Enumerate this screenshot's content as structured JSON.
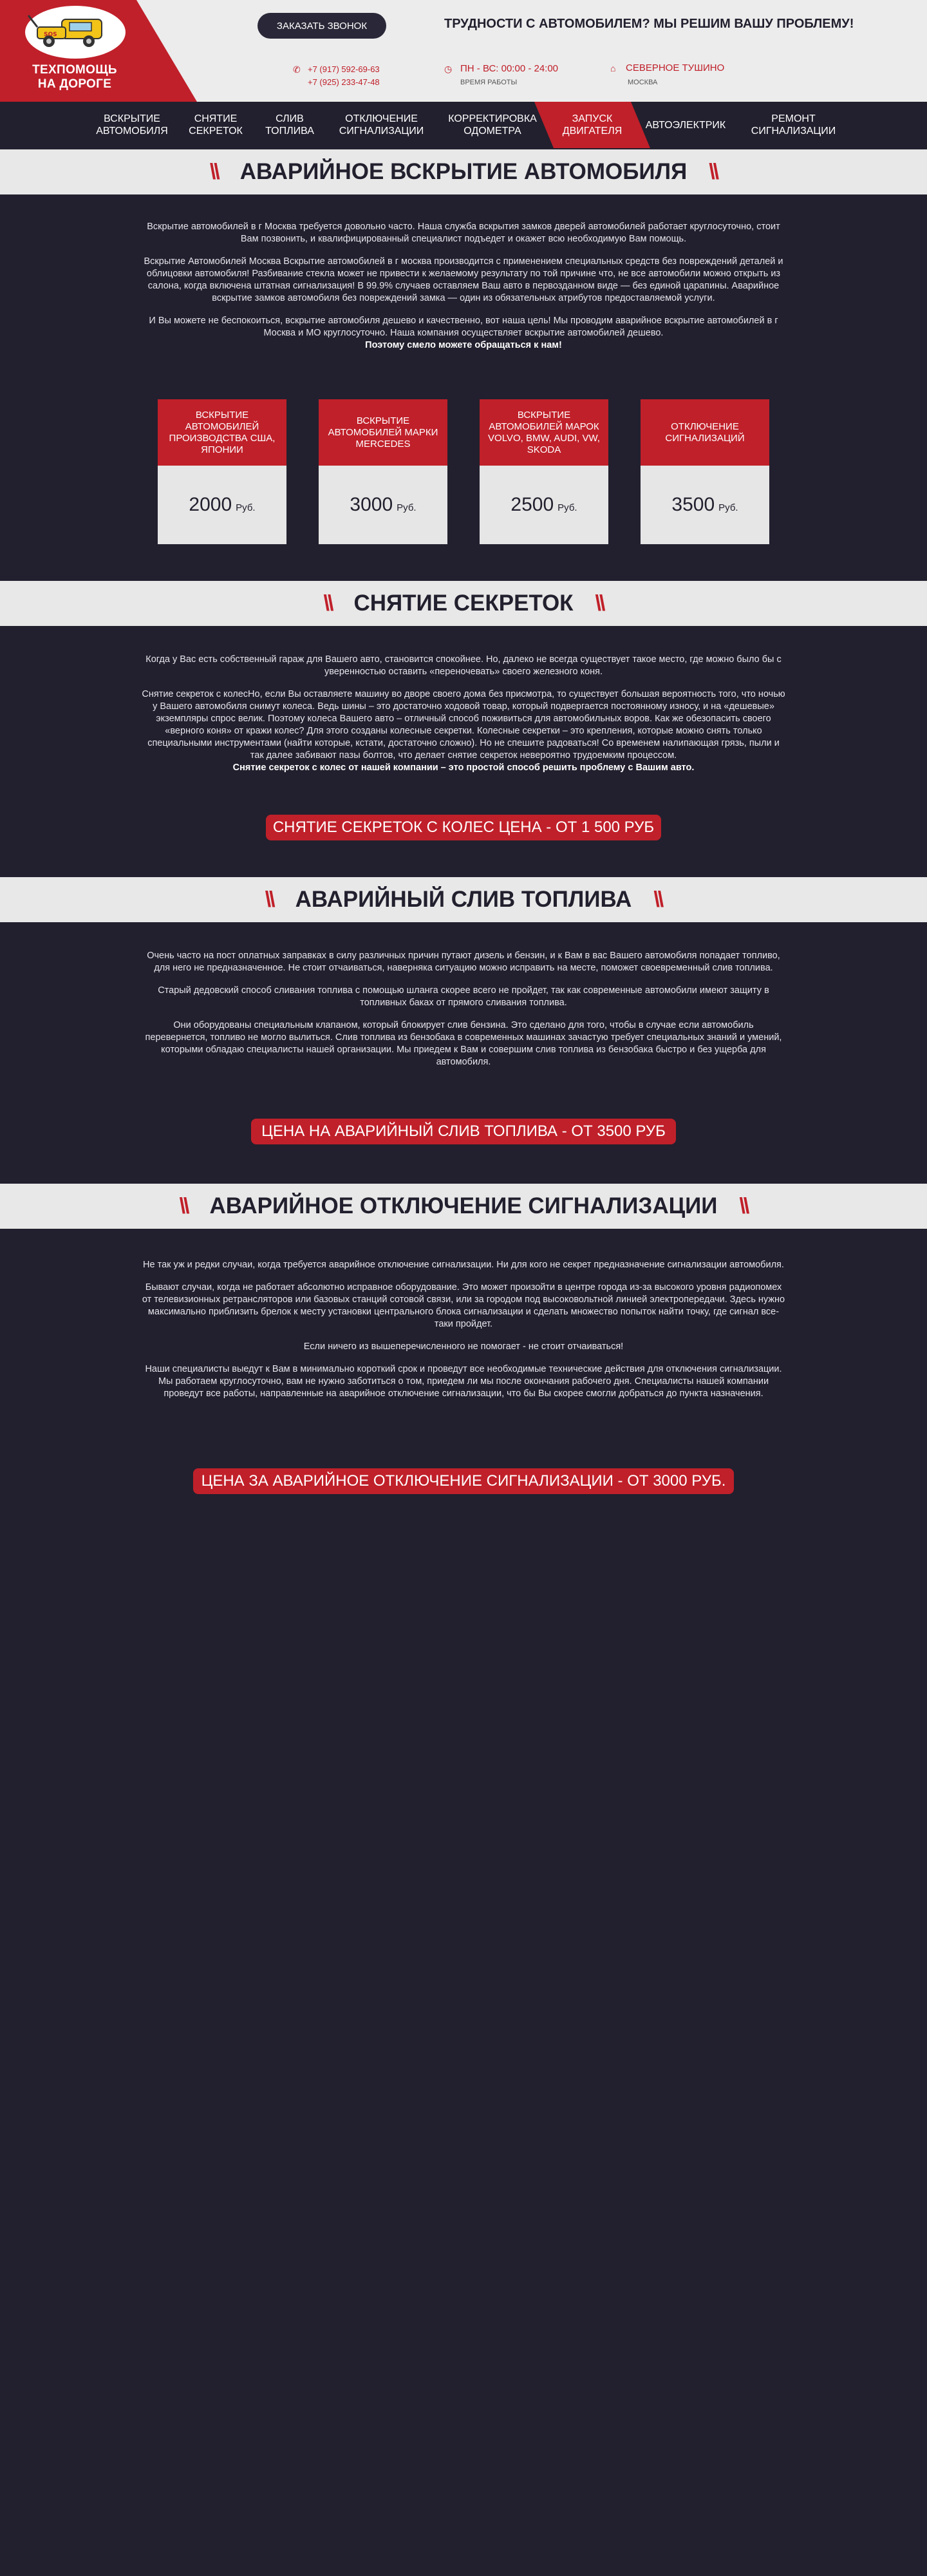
{
  "header": {
    "logo_alt": "tow truck logo",
    "logo_line1": "ТЕХПОМОЩЬ",
    "logo_line2": "НА ДОРОГЕ",
    "callback_label": "ЗАКАЗАТЬ ЗВОНОК",
    "tagline": "ТРУДНОСТИ С АВТОМОБИЛЕМ? МЫ РЕШИМ ВАШУ ПРОБЛЕМУ!",
    "phone1": "+7 (917) 592-69-63",
    "phone2": "+7 (925) 233-47-48",
    "hours": "ПН - ВС: 00:00 - 24:00",
    "hours_label": "ВРЕМЯ РАБОТЫ",
    "location": "СЕВЕРНОЕ ТУШИНО",
    "city": "МОСКВА",
    "icons": {
      "phone": "phone-icon",
      "clock": "clock-icon",
      "home": "home-icon"
    },
    "brand_color": "#c0202a"
  },
  "nav": [
    {
      "l1": "ВСКРЫТИЕ",
      "l2": "АВТОМОБИЛЯ"
    },
    {
      "l1": "СНЯТИЕ",
      "l2": "СЕКРЕТОК"
    },
    {
      "l1": "СЛИВ",
      "l2": "ТОПЛИВА"
    },
    {
      "l1": "ОТКЛЮЧЕНИЕ",
      "l2": "СИГНАЛИЗАЦИИ"
    },
    {
      "l1": "КОРРЕКТИРОВКА",
      "l2": "ОДОМЕТРА"
    },
    {
      "l1": "ЗАПУСК",
      "l2": "ДВИГАТЕЛЯ"
    },
    {
      "l1": "АВТОЭЛЕКТРИК",
      "l2": ""
    },
    {
      "l1": "РЕМОНТ",
      "l2": "СИГНАЛИЗАЦИИ"
    }
  ],
  "sections": {
    "s1": {
      "title": "АВАРИЙНОЕ ВСКРЫТИЕ АВТОМОБИЛЯ",
      "p1": "Вскрытие автомобилей в г Москва требуется довольно часто. Наша служба вскрытия замков дверей автомобилей работает круглосуточно, стоит Вам позвонить, и квалифицированный специалист подъедет и окажет всю необходимую Вам помощь.",
      "p2": "Вскрытие Автомобилей Москва Вскрытие автомобилей в г москва производится с применением специальных средств без повреждений деталей и облицовки автомобиля! Разбивание стекла может не привести к желаемому результату по той причине что, не все автомобили можно открыть из салона, когда включена штатная сигнализация! В 99.9% случаев оставляем Ваш авто в первозданном виде — без единой царапины. Аварийное вскрытие замков автомобиля без повреждений замка — один из обязательных атрибутов предоставляемой услуги.",
      "p3": "И Вы можете не беспокоиться, вскрытие автомобиля дешево и качественно, вот наша цель! Мы проводим аварийное вскрытие автомобилей в г Москва и МО круглосуточно. Наша компания осуществляет вскрытие автомобилей дешево.",
      "p3b": "Поэтому смело можете обращаться к нам!",
      "cards": [
        {
          "title": "ВСКРЫТИЕ АВТОМОБИЛЕЙ ПРОИЗВОДСТВА США, ЯПОНИИ",
          "price": "2000",
          "cur": "Руб."
        },
        {
          "title": "ВСКРЫТИЕ АВТОМОБИЛЕЙ МАРКИ MERCEDES",
          "price": "3000",
          "cur": "Руб."
        },
        {
          "title": "ВСКРЫТИЕ АВТОМОБИЛЕЙ МАРОК VOLVO, BMW, AUDI, VW, SKODA",
          "price": "2500",
          "cur": "Руб."
        },
        {
          "title": "ОТКЛЮЧЕНИЕ СИГНАЛИЗАЦИЙ",
          "price": "3500",
          "cur": "Руб."
        }
      ]
    },
    "s2": {
      "title": "СНЯТИЕ СЕКРЕТОК",
      "p1": "Когда у Вас есть собственный гараж для Вашего авто, становится спокойнее. Но, далеко не всегда существует такое место, где можно было бы с уверенностью оставить «переночевать» своего железного коня.",
      "p2": "Снятие секреток с колесНо, если Вы оставляете машину во дворе своего дома без присмотра, то существует большая вероятность того, что ночью у Вашего автомобиля снимут колеса. Ведь шины – это достаточно ходовой товар, который подвергается постоянному износу, и на «дешевые» экземпляры спрос велик. Поэтому колеса Вашего авто – отличный способ поживиться для автомобильных воров. Как же обезопасить своего «верного коня» от кражи колес? Для этого созданы колесные секретки. Колесные секретки – это крепления, которые можно снять только специальными инструментами (найти которые, кстати, достаточно сложно). Но не спешите радоваться! Со временем налипающая грязь, пыли и так далее забивают пазы болтов, что делает снятие секреток невероятно трудоемким процессом.",
      "p2b": "Снятие секреток с колес от нашей компании – это простой способ решить проблему с Вашим авто.",
      "cta": "СНЯТИЕ СЕКРЕТОК С КОЛЕС ЦЕНА - ОТ 1 500 РУБ"
    },
    "s3": {
      "title": "АВАРИЙНЫЙ СЛИВ ТОПЛИВА",
      "p1": "Очень часто на пост оплатных заправках в силу различных причин путают дизель и бензин, и к Вам в вас Вашего автомобиля попадает топливо, для него не предназначенное. Не стоит отчаиваться, наверняка ситуацию можно исправить на месте, поможет своевременный слив топлива.",
      "p2": "Старый дедовский способ сливания топлива с помощью шланга скорее всего не пройдет, так как современные автомобили имеют защиту в топливных баках от прямого сливания топлива.",
      "p3": "Они оборудованы специальным клапаном, который блокирует слив бензина. Это сделано для того, чтобы в случае если автомобиль перевернется, топливо не могло вылиться. Слив топлива из бензобака в современных машинах зачастую требует специальных знаний и умений, которыми обладаю специалисты нашей организации. Мы приедем к Вам и совершим слив топлива из бензобака быстро и без ущерба для автомобиля.",
      "cta": "ЦЕНА НА АВАРИЙНЫЙ СЛИВ ТОПЛИВА - ОТ 3500 РУБ"
    },
    "s4": {
      "title": "АВАРИЙНОЕ ОТКЛЮЧЕНИЕ СИГНАЛИЗАЦИИ",
      "p1": "Не так уж и редки случаи, когда требуется аварийное отключение сигнализации. Ни для кого не секрет предназначение сигнализации автомобиля.",
      "p2": "Бывают случаи, когда не работает абсолютно исправное оборудование. Это может произойти в центре города из-за высокого уровня радиопомех от телевизионных ретрансляторов или базовых станций сотовой связи, или за городом под высоковольтной линией электропередачи. Здесь нужно максимально приблизить брелок к месту установки центрального блока сигнализации и сделать множество попыток найти точку, где сигнал все-таки пройдет.",
      "p3": "Если ничего из вышеперечисленного не помогает - не стоит отчаиваться!",
      "p4": "Наши специалисты выедут к Вам в минимально короткий срок и проведут все необходимые технические действия для отключения сигнализации. Мы работаем круглосуточно, вам не нужно заботиться о том, приедем ли мы после окончания рабочего дня. Специалисты нашей компании проведут все работы, направленные на аварийное отключение сигнализации, что бы Вы скорее смогли добраться до пункта назначения.",
      "cta": "ЦЕНА ЗА АВАРИЙНОЕ ОТКЛЮЧЕНИЕ СИГНАЛИЗАЦИИ - ОТ 3000 РУБ."
    }
  }
}
